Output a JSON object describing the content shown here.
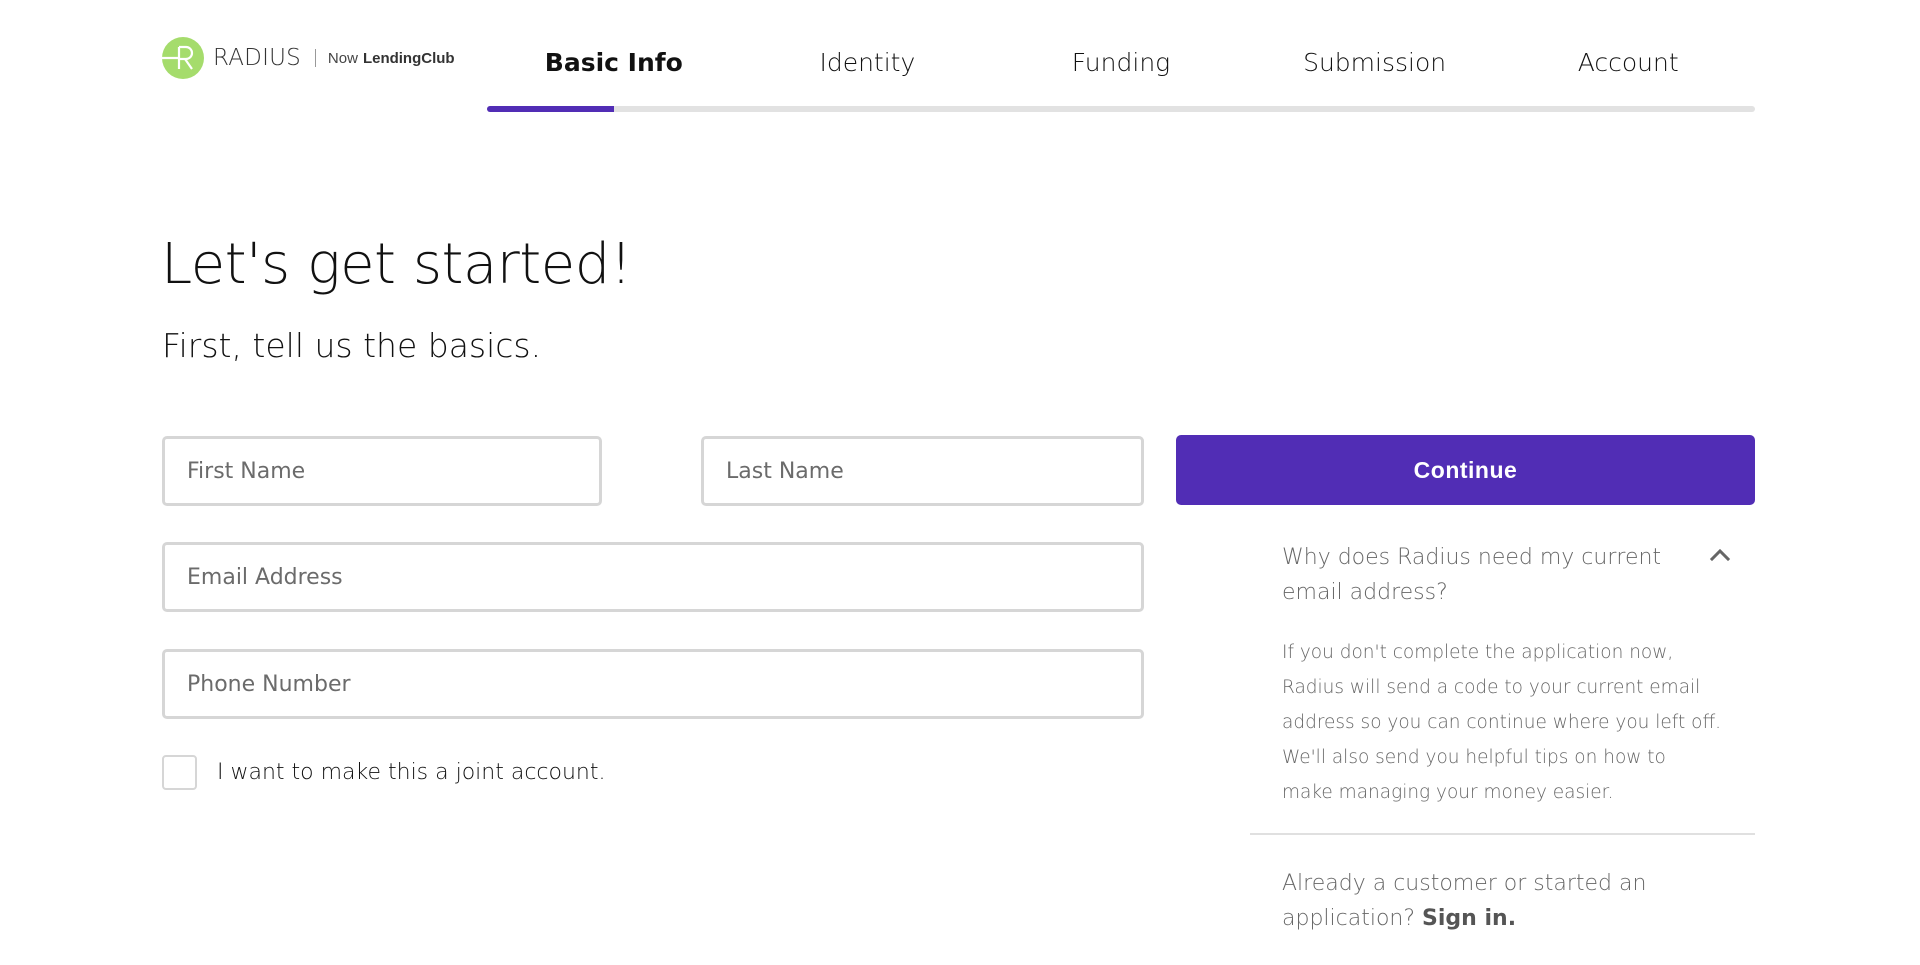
{
  "brand": {
    "name": "RADIUS",
    "now_label": "Now",
    "partner": "LendingClub",
    "logo_color": "#a5dc6c"
  },
  "steps": {
    "items": [
      {
        "label": "Basic Info",
        "active": true
      },
      {
        "label": "Identity",
        "active": false
      },
      {
        "label": "Funding",
        "active": false
      },
      {
        "label": "Submission",
        "active": false
      },
      {
        "label": "Account",
        "active": false
      }
    ],
    "progress_percent": 10,
    "accent_color": "#512db5"
  },
  "heading": {
    "title": "Let's get started!",
    "subtitle": "First, tell us the basics."
  },
  "form": {
    "first_name": {
      "placeholder": "First Name",
      "value": ""
    },
    "last_name": {
      "placeholder": "Last Name",
      "value": ""
    },
    "email": {
      "placeholder": "Email Address",
      "value": ""
    },
    "phone": {
      "placeholder": "Phone Number",
      "value": ""
    },
    "joint_account": {
      "label": "I want to make this a joint account.",
      "checked": false
    }
  },
  "sidebar": {
    "continue_label": "Continue",
    "faq": {
      "question": "Why does Radius need my current email address?",
      "answer": "If you don't complete the application now, Radius will send a code to your current email address so you can continue where you left off. We'll also send you helpful tips on how to make managing your money easier.",
      "expanded": true,
      "toggle_icon": "chevron-up-icon"
    },
    "signin": {
      "prompt": "Already a customer or started an application?",
      "link_label": "Sign in."
    }
  }
}
